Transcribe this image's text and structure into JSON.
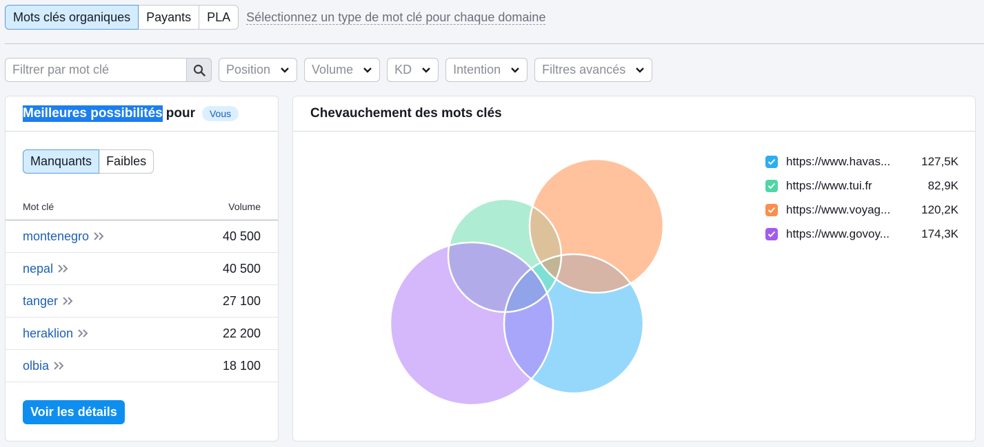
{
  "type_selector": {
    "options": [
      "Mots clés organiques",
      "Payants",
      "PLA"
    ],
    "hint": "Sélectionnez un type de mot clé pour chaque domaine"
  },
  "filters": {
    "search_placeholder": "Filtrer par mot clé",
    "dropdowns": [
      "Position",
      "Volume",
      "KD",
      "Intention",
      "Filtres avancés"
    ]
  },
  "left_panel": {
    "title_highlight": "Meilleures possibilités",
    "title_rest": "pour",
    "badge": "Vous",
    "tabs": [
      "Manquants",
      "Faibles"
    ],
    "col_keyword": "Mot clé",
    "col_volume": "Volume",
    "rows": [
      {
        "keyword": "montenegro",
        "volume": "40 500"
      },
      {
        "keyword": "nepal",
        "volume": "40 500"
      },
      {
        "keyword": "tanger",
        "volume": "27 100"
      },
      {
        "keyword": "heraklion",
        "volume": "22 200"
      },
      {
        "keyword": "olbia",
        "volume": "18 100"
      }
    ],
    "details_button": "Voir les détails"
  },
  "right_panel": {
    "title": "Chevauchement des mots clés",
    "legend": [
      {
        "url": "https://www.havas...",
        "value": "127,5K",
        "color": "#2eadf2"
      },
      {
        "url": "https://www.tui.fr",
        "value": "82,9K",
        "color": "#4fd6a6"
      },
      {
        "url": "https://www.voyag...",
        "value": "120,2K",
        "color": "#fc8e4c"
      },
      {
        "url": "https://www.govoy...",
        "value": "174,3K",
        "color": "#a25af0"
      }
    ]
  },
  "icons": {
    "search": "search-icon",
    "chevron": "chevron-down-icon",
    "double_chevron": "double-chevron-right-icon",
    "checkbox": "checkbox-checked-icon"
  }
}
